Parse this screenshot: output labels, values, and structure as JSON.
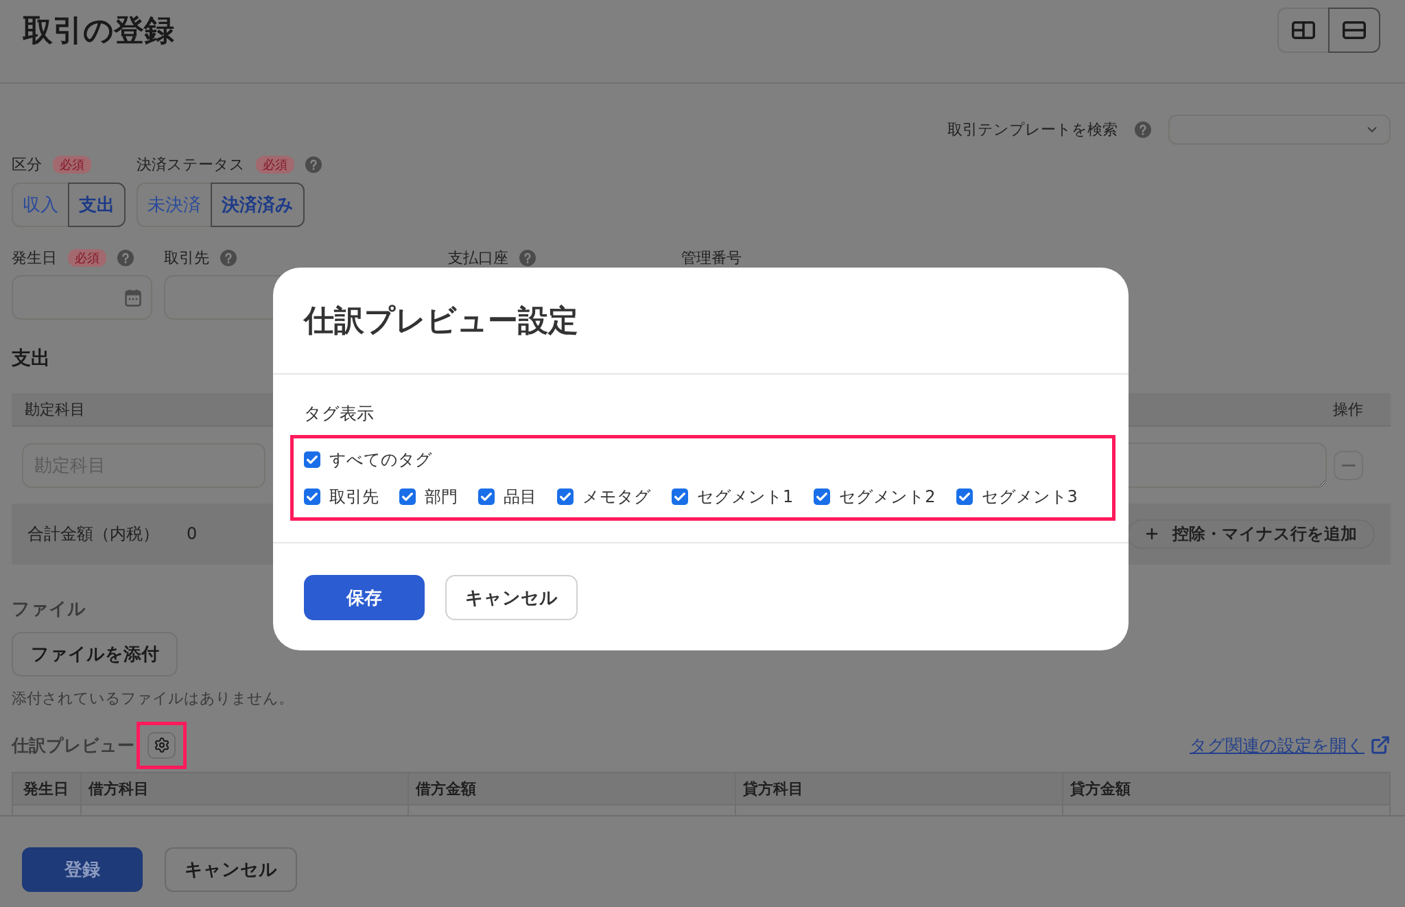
{
  "header": {
    "title": "取引の登録",
    "view_modes": [
      {
        "kind": "split",
        "selected": false
      },
      {
        "kind": "stacked",
        "selected": true
      }
    ]
  },
  "template_search": {
    "label": "取引テンプレートを検索",
    "help": true
  },
  "status_fields": [
    {
      "label": "区分",
      "required": "必須",
      "options": [
        {
          "label": "収入",
          "selected": false
        },
        {
          "label": "支出",
          "selected": true
        }
      ]
    },
    {
      "label": "決済ステータス",
      "required": "必須",
      "help": true,
      "options": [
        {
          "label": "未決済",
          "selected": false
        },
        {
          "label": "決済済み",
          "selected": true
        }
      ]
    }
  ],
  "detail_fields": {
    "labels": [
      {
        "label": "発生日",
        "required": "必須",
        "help": true
      },
      {
        "label": "取引先",
        "help": true
      },
      {
        "label": "支払口座",
        "help": true
      },
      {
        "label": "管理番号"
      }
    ],
    "inputs": [
      {
        "kind": "date"
      },
      {
        "kind": "text"
      }
    ]
  },
  "expense": {
    "title": "支出",
    "columns": [
      "勘定科目",
      "操作"
    ],
    "rows": [
      {
        "account_placeholder": "勘定科目"
      }
    ],
    "total_label": "合計金額（内税）",
    "total_value": "0",
    "add_button": "控除・マイナス行を追加"
  },
  "files": {
    "title": "ファイル",
    "attach_button": "ファイルを添付",
    "empty_note": "添付されているファイルはありません。"
  },
  "journal_preview": {
    "title": "仕訳プレビュー",
    "settings_highlighted": true,
    "link": "タグ関連の設定を開く",
    "columns": [
      "発生日",
      "借方科目",
      "借方金額",
      "貸方科目",
      "貸方金額"
    ]
  },
  "footer": {
    "buttons": [
      {
        "label": "登録",
        "kind": "primary"
      },
      {
        "label": "キャンセル",
        "kind": "secondary"
      }
    ]
  },
  "modal": {
    "title": "仕訳プレビュー設定",
    "section_label": "タグ表示",
    "highlighted": true,
    "all_tags": {
      "label": "すべてのタグ",
      "checked": true
    },
    "tags": [
      {
        "label": "取引先",
        "checked": true
      },
      {
        "label": "部門",
        "checked": true
      },
      {
        "label": "品目",
        "checked": true
      },
      {
        "label": "メモタグ",
        "checked": true
      },
      {
        "label": "セグメント1",
        "checked": true
      },
      {
        "label": "セグメント2",
        "checked": true
      },
      {
        "label": "セグメント3",
        "checked": true
      }
    ],
    "buttons": [
      {
        "label": "保存",
        "kind": "primary"
      },
      {
        "label": "キャンセル",
        "kind": "secondary"
      }
    ]
  }
}
